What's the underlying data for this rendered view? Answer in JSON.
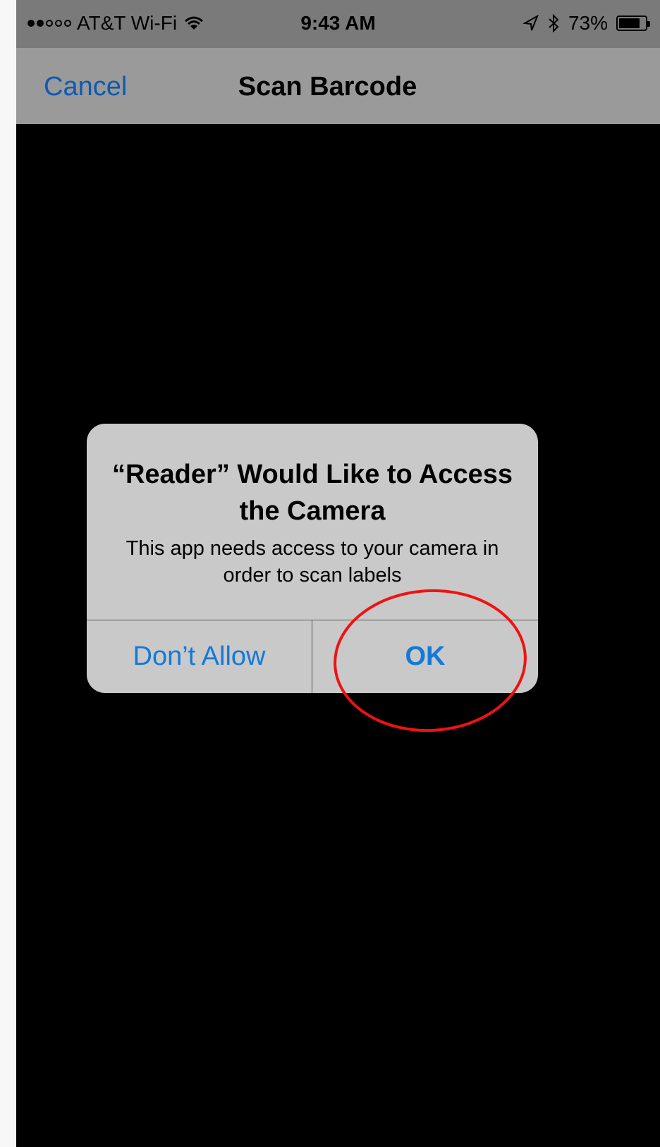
{
  "status_bar": {
    "carrier": "AT&T Wi-Fi",
    "signal_bars": 2,
    "signal_total": 5,
    "time": "9:43 AM",
    "battery": "73%",
    "battery_level": 0.73,
    "icons": [
      "wifi-icon",
      "location-icon",
      "bluetooth-icon",
      "battery-icon"
    ]
  },
  "nav": {
    "cancel_label": "Cancel",
    "title": "Scan Barcode"
  },
  "alert": {
    "title": "“Reader” Would Like to Access the Camera",
    "message": "This app needs access to your camera in order to scan labels",
    "dont_allow_label": "Don’t Allow",
    "ok_label": "OK"
  },
  "colors": {
    "accent": "#1279d9",
    "cancel": "#0d5ab3",
    "highlight": "#f01212"
  }
}
